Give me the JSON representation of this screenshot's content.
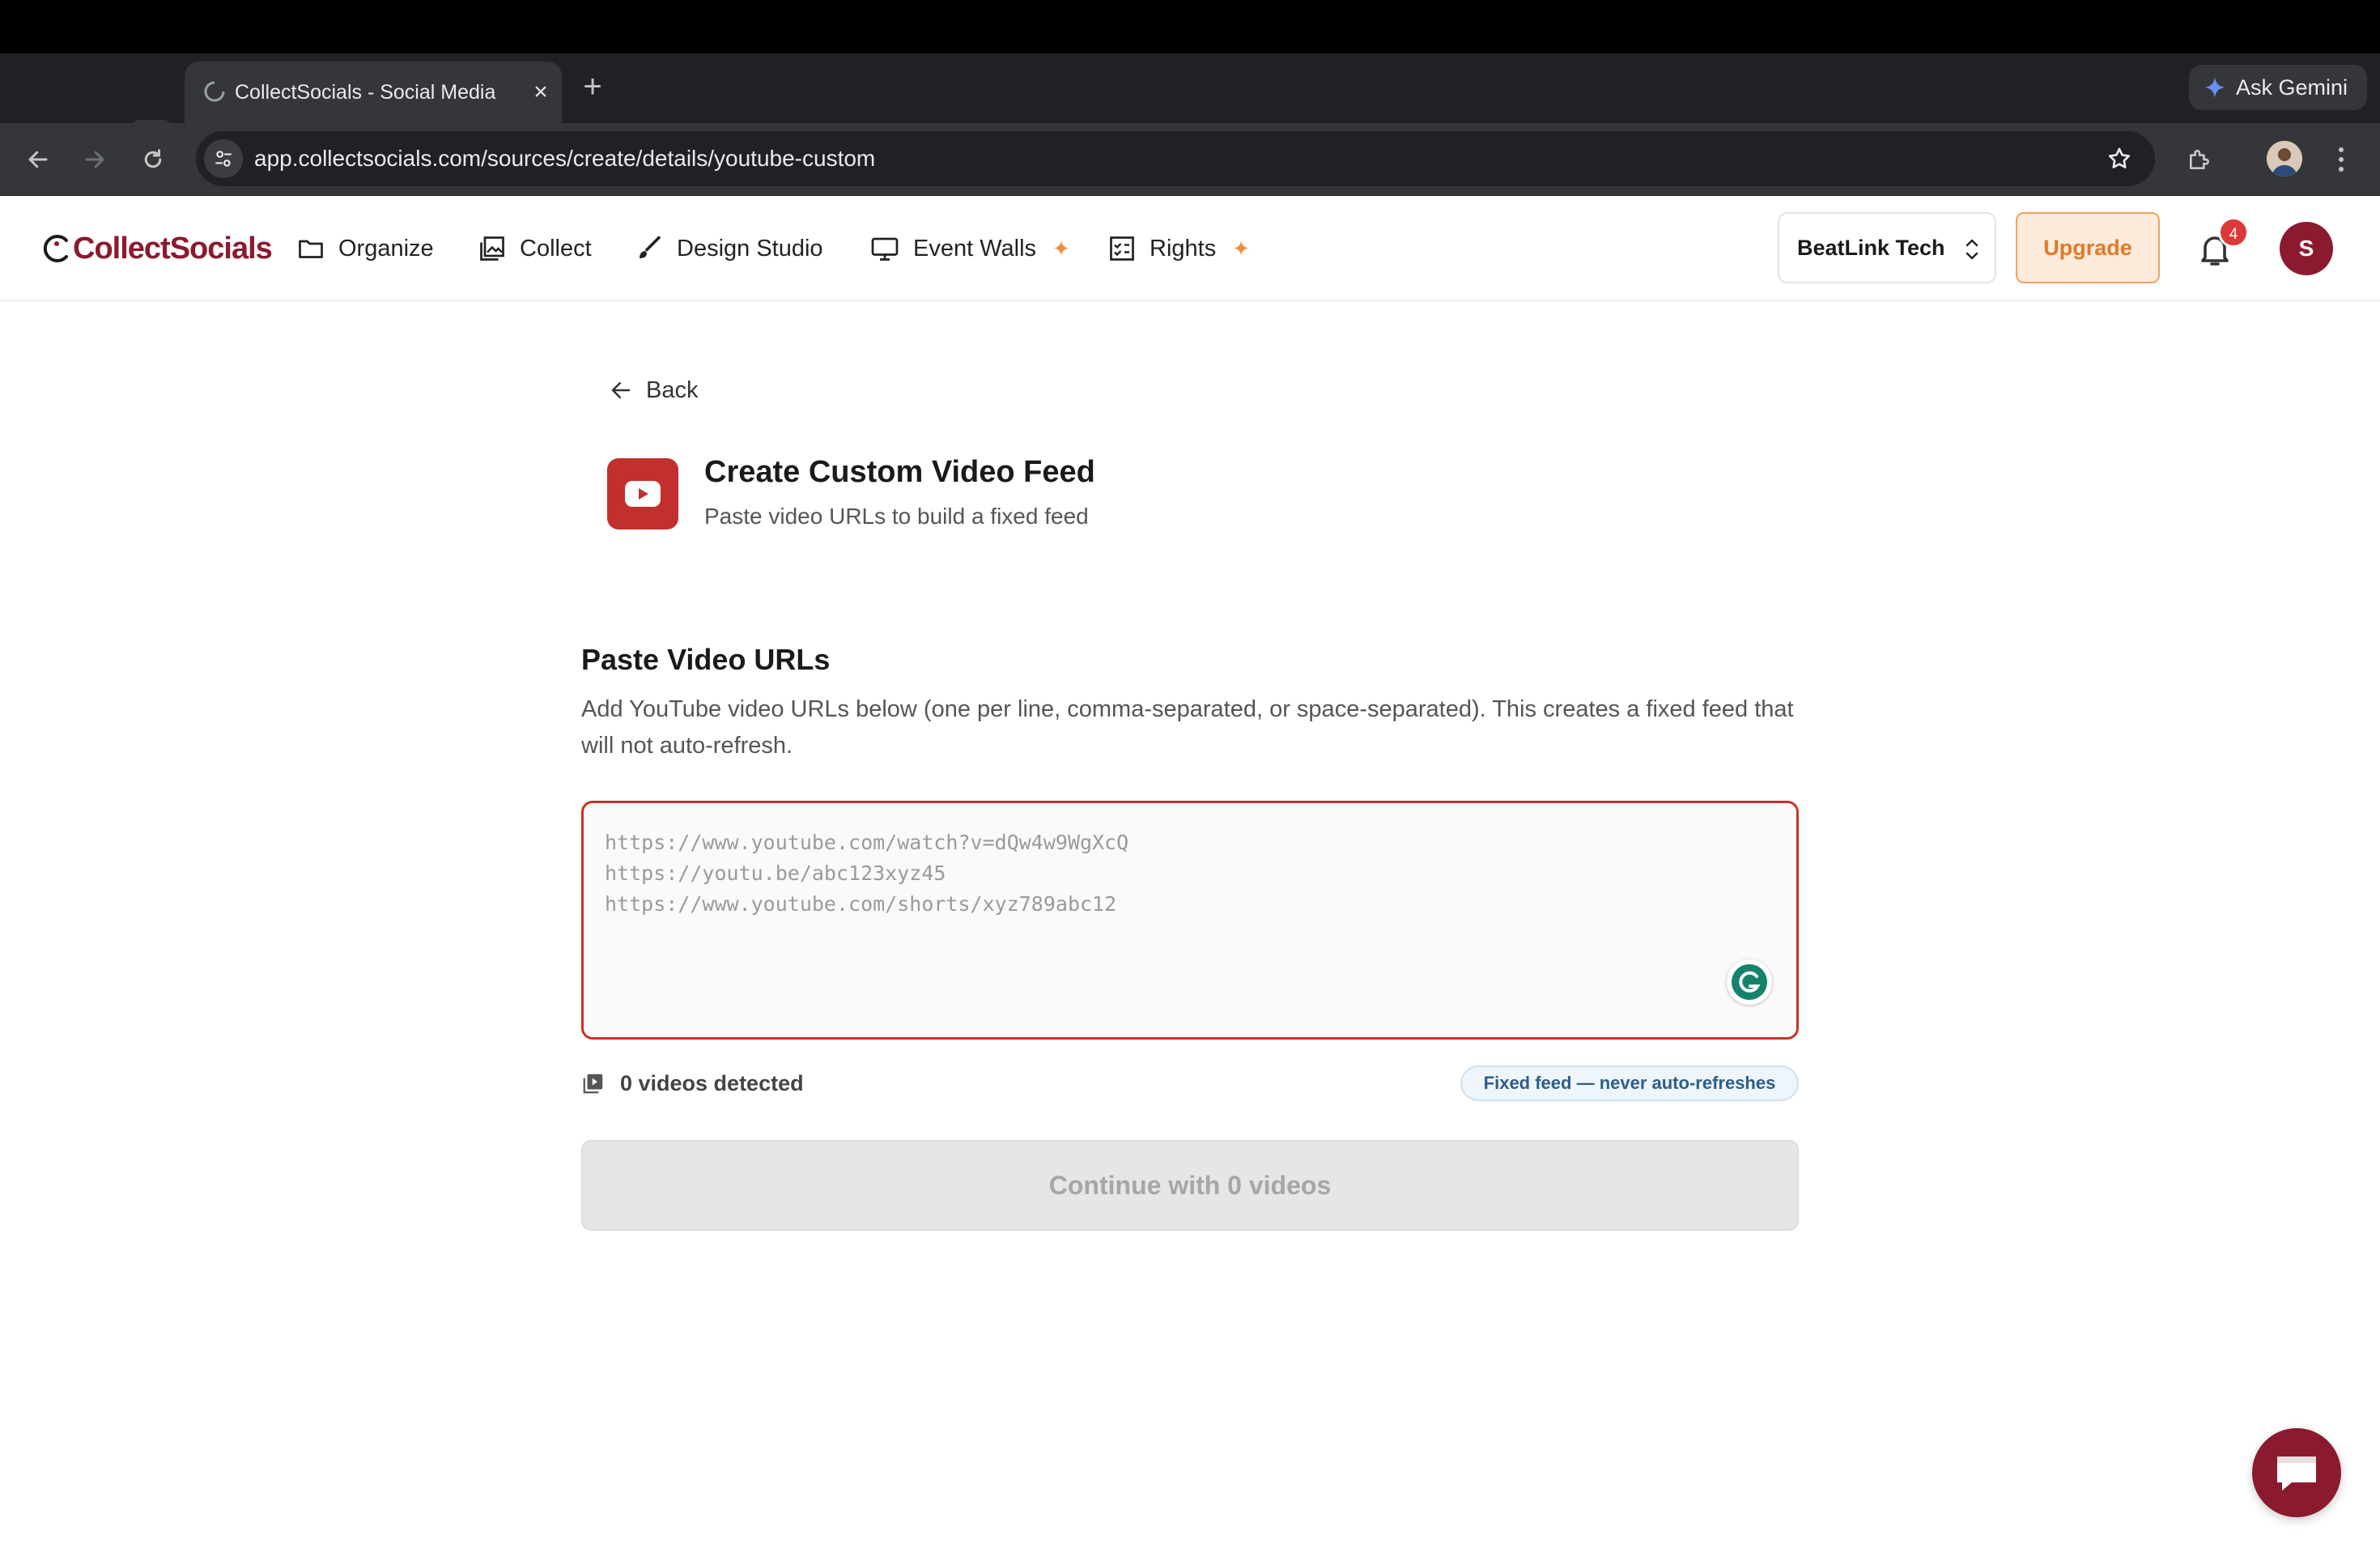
{
  "browser": {
    "tab_title": "CollectSocials - Social Media",
    "tab_close": "×",
    "new_tab": "+",
    "gemini_label": "Ask Gemini",
    "url": "app.collectsocials.com/sources/create/details/youtube-custom"
  },
  "header": {
    "logo_text": "CollectSocials",
    "nav": [
      {
        "label": "Organize",
        "icon": "folder-icon"
      },
      {
        "label": "Collect",
        "icon": "image-icon"
      },
      {
        "label": "Design Studio",
        "icon": "brush-icon"
      },
      {
        "label": "Event Walls",
        "icon": "monitor-icon",
        "sparkle": true
      },
      {
        "label": "Rights",
        "icon": "checklist-icon",
        "sparkle": true
      }
    ],
    "sparkle": "✦",
    "workspace": "BeatLink Tech",
    "upgrade_label": "Upgrade",
    "notification_count": "4",
    "avatar_initial": "S"
  },
  "page": {
    "back_label": "Back",
    "title": "Create Custom Video Feed",
    "subtitle": "Paste video URLs to build a fixed feed",
    "section_title": "Paste Video URLs",
    "section_desc": "Add YouTube video URLs below (one per line, comma-separated, or space-separated). This creates a fixed feed that will not auto-refresh.",
    "placeholder_lines": "https://www.youtube.com/watch?v=dQw4w9WgXcQ\nhttps://youtu.be/abc123xyz45\nhttps://www.youtube.com/shorts/xyz789abc12",
    "detected_label": "0 videos detected",
    "fixed_badge": "Fixed feed — never auto-refreshes",
    "continue_label": "Continue with 0 videos"
  },
  "colors": {
    "brand": "#8b1a2f",
    "accent_orange": "#e07a2a",
    "error_border": "#c9302c",
    "youtube_red": "#c22f2f"
  }
}
